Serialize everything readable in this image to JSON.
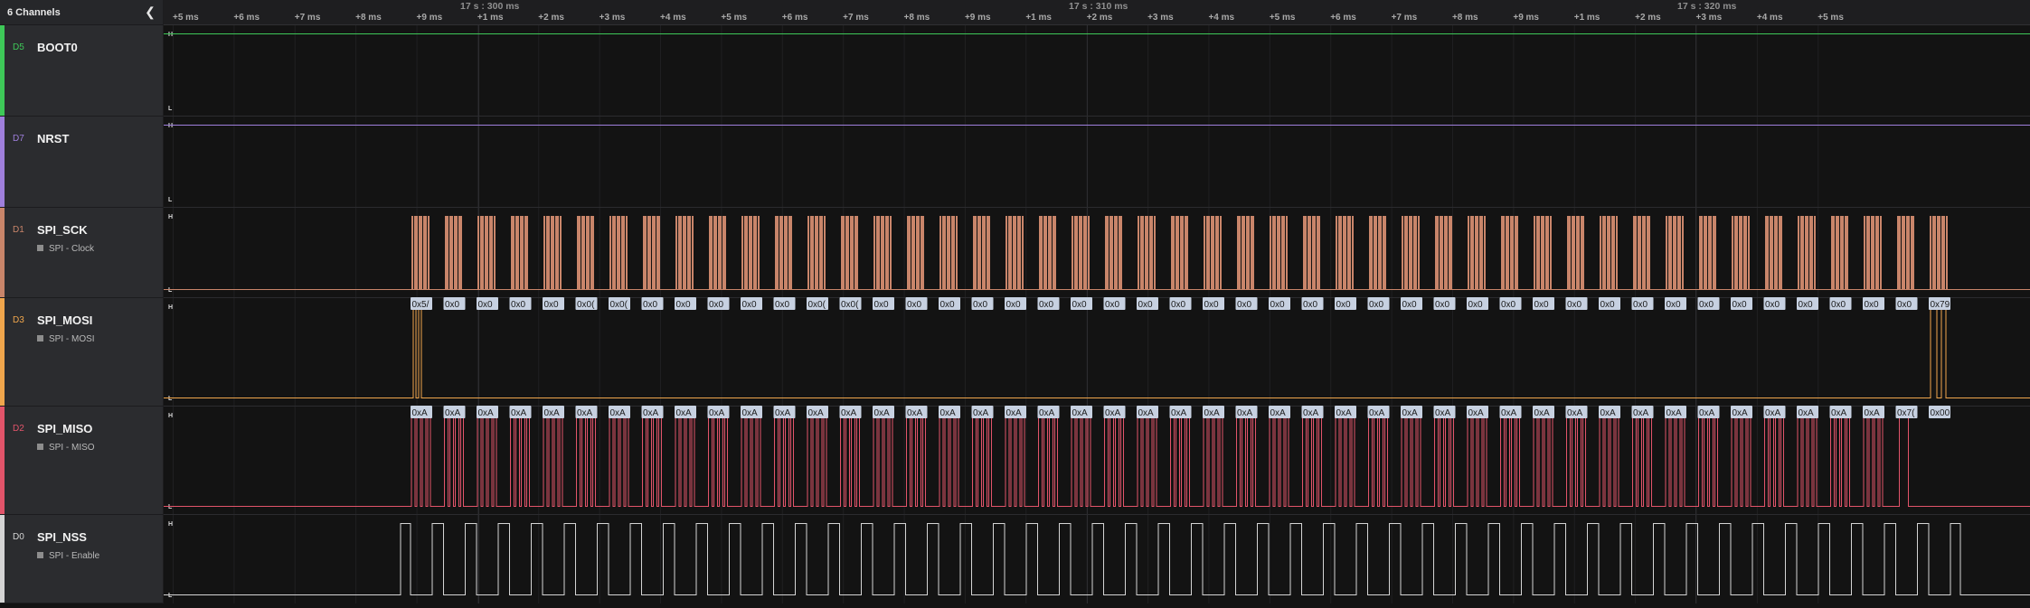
{
  "sidebar": {
    "title": "6 Channels",
    "collapse_icon": "chevron-left-icon"
  },
  "channels": [
    {
      "id": "D5",
      "name": "BOOT0",
      "analyzer": "",
      "color": "#3ec858",
      "level": "H",
      "kind": "high"
    },
    {
      "id": "D7",
      "name": "NRST",
      "analyzer": "",
      "color": "#9f7fdc",
      "level": "H",
      "kind": "high"
    },
    {
      "id": "D1",
      "name": "SPI_SCK",
      "analyzer": "SPI - Clock",
      "color": "#c9856a",
      "kind": "clock"
    },
    {
      "id": "D3",
      "name": "SPI_MOSI",
      "analyzer": "SPI - MOSI",
      "color": "#f0a64c",
      "kind": "mosi"
    },
    {
      "id": "D2",
      "name": "SPI_MISO",
      "analyzer": "SPI - MISO",
      "color": "#e2546a",
      "kind": "miso"
    },
    {
      "id": "D0",
      "name": "SPI_NSS",
      "analyzer": "SPI - Enable",
      "color": "#d4d4d4",
      "kind": "nss"
    }
  ],
  "level_labels": {
    "high": "H",
    "low": "L"
  },
  "timeline": {
    "minor_ticks": [
      "+5 ms",
      "+6 ms",
      "+7 ms",
      "+8 ms",
      "+9 ms",
      "+1 ms",
      "+2 ms",
      "+3 ms",
      "+4 ms",
      "+5 ms",
      "+6 ms",
      "+7 ms",
      "+8 ms",
      "+9 ms",
      "+1 ms",
      "+2 ms",
      "+3 ms",
      "+4 ms",
      "+5 ms",
      "+6 ms",
      "+7 ms",
      "+8 ms",
      "+9 ms",
      "+1 ms",
      "+2 ms",
      "+3 ms",
      "+4 ms",
      "+5 ms"
    ],
    "major_ticks": [
      "17 s : 300 ms",
      "17 s : 310 ms",
      "17 s : 320 ms"
    ]
  },
  "spi": {
    "transfer_count": 47,
    "mosi_bytes": [
      "0x5/",
      "0x0",
      "0x0",
      "0x0",
      "0x0",
      "0x0(",
      "0x0(",
      "0x0",
      "0x0",
      "0x0",
      "0x0",
      "0x0",
      "0x0(",
      "0x0(",
      "0x0",
      "0x0",
      "0x0",
      "0x0",
      "0x0",
      "0x0",
      "0x0",
      "0x0",
      "0x0",
      "0x0",
      "0x0",
      "0x0",
      "0x0",
      "0x0",
      "0x0",
      "0x0",
      "0x0",
      "0x0",
      "0x0",
      "0x0",
      "0x0",
      "0x0",
      "0x0",
      "0x0",
      "0x0",
      "0x0",
      "0x0",
      "0x0",
      "0x0",
      "0x0",
      "0x0",
      "0x0",
      "0x79"
    ],
    "miso_bytes": [
      "0xA",
      "0xA",
      "0xA",
      "0xA",
      "0xA",
      "0xA",
      "0xA",
      "0xA",
      "0xA",
      "0xA",
      "0xA",
      "0xA",
      "0xA",
      "0xA",
      "0xA",
      "0xA",
      "0xA",
      "0xA",
      "0xA",
      "0xA",
      "0xA",
      "0xA",
      "0xA",
      "0xA",
      "0xA",
      "0xA",
      "0xA",
      "0xA",
      "0xA",
      "0xA",
      "0xA",
      "0xA",
      "0xA",
      "0xA",
      "0xA",
      "0xA",
      "0xA",
      "0xA",
      "0xA",
      "0xA",
      "0xA",
      "0xA",
      "0xA",
      "0xA",
      "0xA",
      "0x7(",
      "0x00"
    ]
  }
}
